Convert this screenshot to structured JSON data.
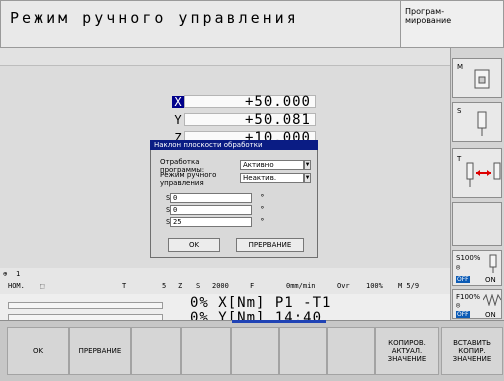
{
  "header": {
    "mode_title": "Режим ручного управления",
    "program_mode": [
      "Програм-",
      "мирование"
    ]
  },
  "coordinates": [
    {
      "axis": "X",
      "value": "+50.000",
      "selected": true
    },
    {
      "axis": "Y",
      "value": "+50.081",
      "selected": false
    },
    {
      "axis": "Z",
      "value": "+10.000",
      "selected": false
    }
  ],
  "dialog": {
    "title": "Наклон плоскости обработки",
    "row1_label": "Отработка программы:",
    "row1_value": "Активно",
    "row2_label": "Режим ручного управления",
    "row2_value": "Неактив.",
    "spins": [
      {
        "label": "SPA",
        "value": "0",
        "unit": "°"
      },
      {
        "label": "SPB",
        "value": "0",
        "unit": "°"
      },
      {
        "label": "SPC",
        "value": "25",
        "unit": "°"
      }
    ],
    "ok_label": "OK",
    "cancel_label": "ПРЕРВАНИЕ"
  },
  "status": {
    "tool_number": "1",
    "nom_label": "НОМ.",
    "t_label": "T",
    "t_value": "5",
    "z_label": "Z",
    "s_label": "S",
    "s_value": "2000",
    "f_label": "F",
    "f_value": "0mm/min",
    "ovr_label": "Ovr",
    "ovr_value": "100%",
    "m_label": "M 5/9",
    "line1": "0% X[Nm] P1  -T1",
    "line2": "0% Y[Nm] 14:40"
  },
  "right_panel": {
    "m_label": "M",
    "s_label": "S",
    "t_label": "T",
    "s100_label": "S100%",
    "f100_label": "F100%",
    "off_label": "OFF",
    "on_label": "ON"
  },
  "softkeys": [
    {
      "label": "OK"
    },
    {
      "label": "ПРЕРВАНИЕ"
    },
    {
      "label": ""
    },
    {
      "label": ""
    },
    {
      "label": ""
    },
    {
      "label": ""
    },
    {
      "label": "КОПИРОВ. АКТУАЛ. ЗНАЧЕНИЕ"
    },
    {
      "label": "ВСТАВИТЬ КОПИР. ЗНАЧЕНИЕ"
    }
  ],
  "colors": {
    "dialog_title_bg": "#0a1c84",
    "axis_highlight": "#00008b",
    "status_blue": "#0c5bb5"
  }
}
